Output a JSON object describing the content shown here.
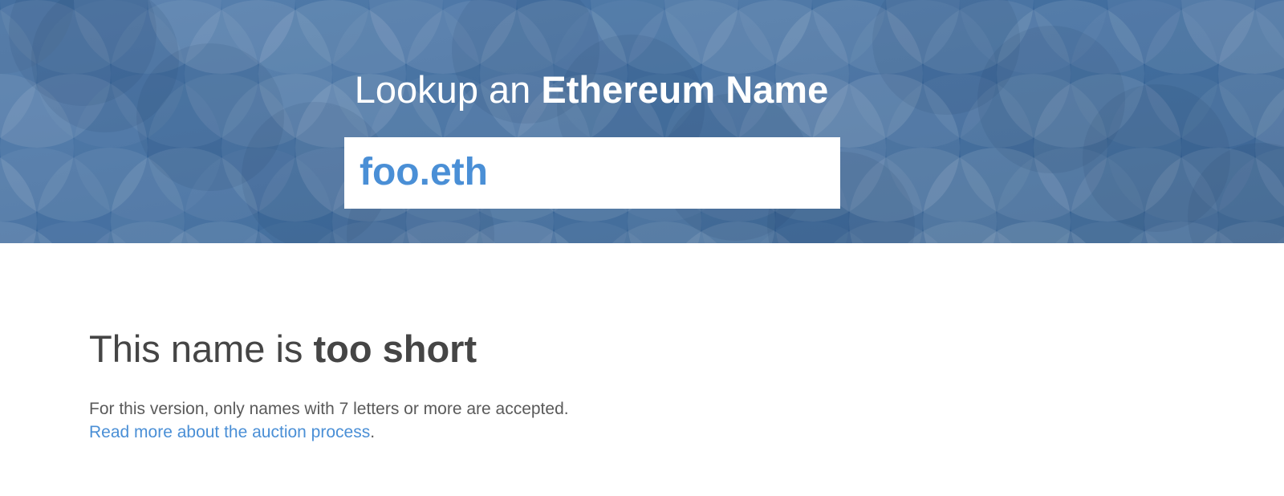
{
  "hero": {
    "title_prefix": "Lookup an ",
    "title_bold": "Ethereum Name",
    "background_color": "#2f5f95",
    "circle_overlay_color": "#ffffff"
  },
  "search": {
    "name_value": "foo",
    "tld_value": ".eth",
    "value_color": "#4a8fd6"
  },
  "result": {
    "title_prefix": "This name is ",
    "title_bold": "too short",
    "message_prefix": "For this version, only names with 7 letters or more are accepted. ",
    "link_text": "Read more about the auction process",
    "message_suffix": ".",
    "link_color": "#4a8fd6"
  }
}
